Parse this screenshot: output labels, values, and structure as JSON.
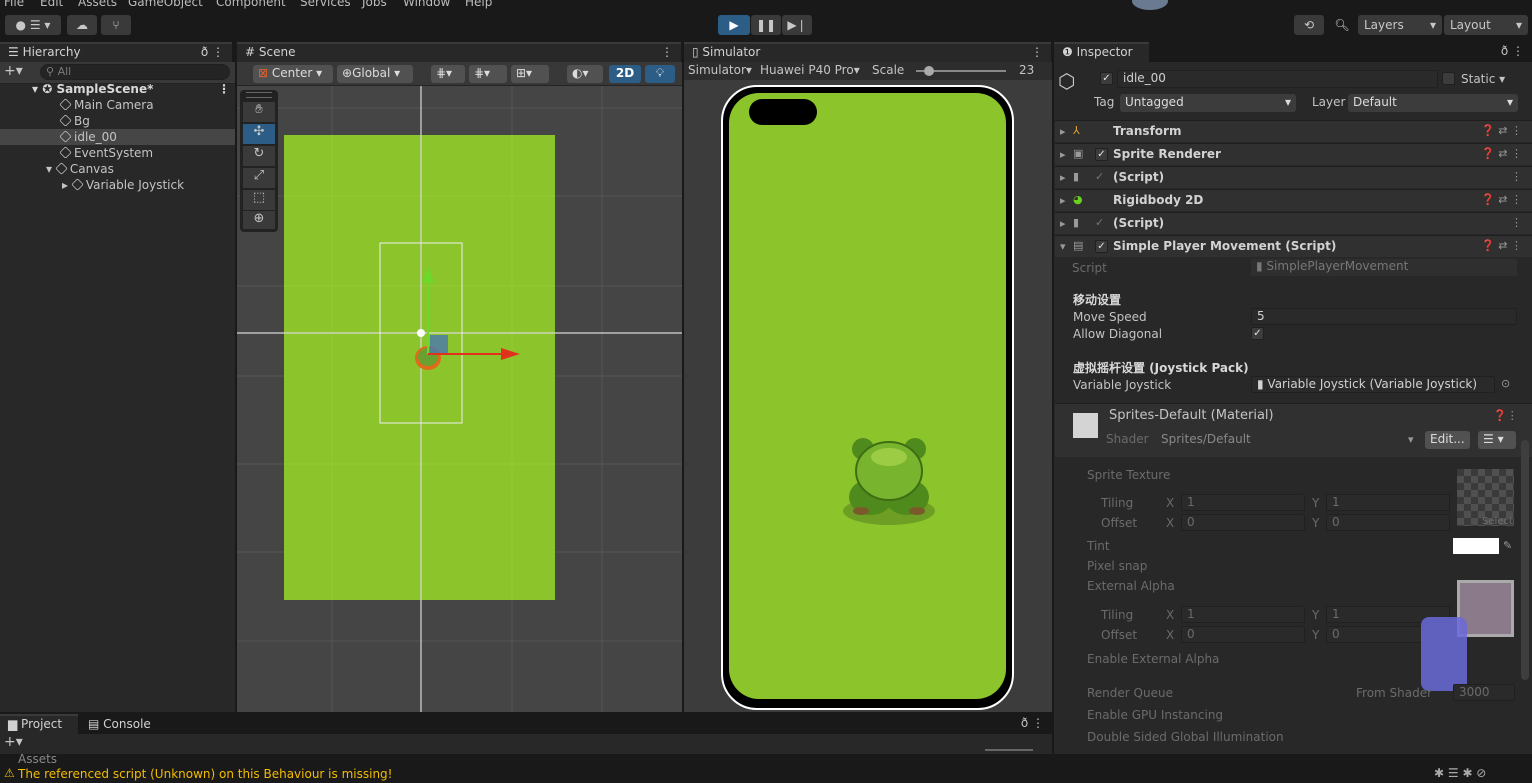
{
  "menu": [
    "File",
    "Edit",
    "Assets",
    "GameObject",
    "Component",
    "Services",
    "Jobs",
    "Window",
    "Help"
  ],
  "toolbar": {
    "layers": "Layers",
    "layout": "Layout"
  },
  "hierarchy": {
    "tab": "Hierarchy",
    "search_placeholder": "All",
    "scene": "SampleScene*",
    "items": [
      "Main Camera",
      "Bg",
      "idle_00",
      "EventSystem",
      "Canvas",
      "Variable Joystick"
    ]
  },
  "scene": {
    "tab": "Scene",
    "pivot": "Center",
    "space": "Global",
    "mode2d": "2D"
  },
  "simulator": {
    "tab": "Simulator",
    "mode": "Simulator",
    "device": "Huawei P40 Pro",
    "scale_label": "Scale",
    "scale_value": "23"
  },
  "inspector": {
    "tab": "Inspector",
    "object_name": "idle_00",
    "static_label": "Static",
    "tag_label": "Tag",
    "tag_value": "Untagged",
    "layer_label": "Layer",
    "layer_value": "Default",
    "components": [
      "Transform",
      "Sprite Renderer",
      "(Script)",
      "Rigidbody 2D",
      "(Script)",
      "Simple Player Movement (Script)"
    ],
    "script_label": "Script",
    "script_value": "SimplePlayerMovement",
    "header_move": "移动设置",
    "move_speed_label": "Move Speed",
    "move_speed_value": "5",
    "allow_diagonal_label": "Allow Diagonal",
    "header_joystick": "虚拟摇杆设置 (Joystick Pack)",
    "joystick_label": "Variable Joystick",
    "joystick_value": "Variable Joystick (Variable Joystick)",
    "material_name": "Sprites-Default (Material)",
    "shader_label": "Shader",
    "shader_value": "Sprites/Default",
    "edit_label": "Edit...",
    "sprite_texture": "Sprite Texture",
    "tiling": "Tiling",
    "offset": "Offset",
    "x": "X",
    "y": "Y",
    "one": "1",
    "zero": "0",
    "select": "Select",
    "tint": "Tint",
    "pixel_snap": "Pixel snap",
    "external_alpha": "External Alpha",
    "enable_external_alpha": "Enable External Alpha",
    "render_queue": "Render Queue",
    "render_queue_mode": "From Shader",
    "render_queue_value": "3000",
    "gpu_instancing": "Enable GPU Instancing",
    "double_sided": "Double Sided Global Illumination"
  },
  "bottom": {
    "project_tab": "Project",
    "console_tab": "Console",
    "assets": "Assets"
  },
  "status": {
    "message": "The referenced script (Unknown) on this Behaviour is missing!"
  },
  "colors": {
    "accent": "#2c5d87",
    "green_bg": "#8cc42c",
    "warning": "#f4bc02"
  }
}
